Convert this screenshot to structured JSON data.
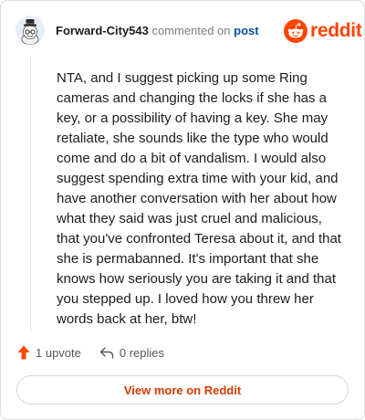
{
  "header": {
    "author": "Forward-City543",
    "action": "commented on",
    "post_link": "post",
    "brand_name": "reddit",
    "brand_color": "#ff4500"
  },
  "avatar": {
    "icon": "avatar-snoo-hat"
  },
  "comment": {
    "body": "NTA, and I suggest picking up some Ring cameras and changing the locks if she has a key, or a possibility of having a key. She may retaliate, she sounds like the type who would come and do a bit of vandalism. I would also suggest spending extra time with your kid, and have another conversation with her about how what they said was just cruel and malicious, that you've confronted Teresa about it, and that she is permabanned. It's important that she knows how seriously you are taking it and that you stepped up. I loved how you threw her words back at her, btw!"
  },
  "actions": {
    "upvote_icon": "upvote-arrow-icon",
    "upvote_label": "1 upvote",
    "reply_icon": "reply-icon",
    "replies_label": "0 replies"
  },
  "footer": {
    "more_button": "View more on Reddit",
    "accent_color": "#d93a00"
  }
}
